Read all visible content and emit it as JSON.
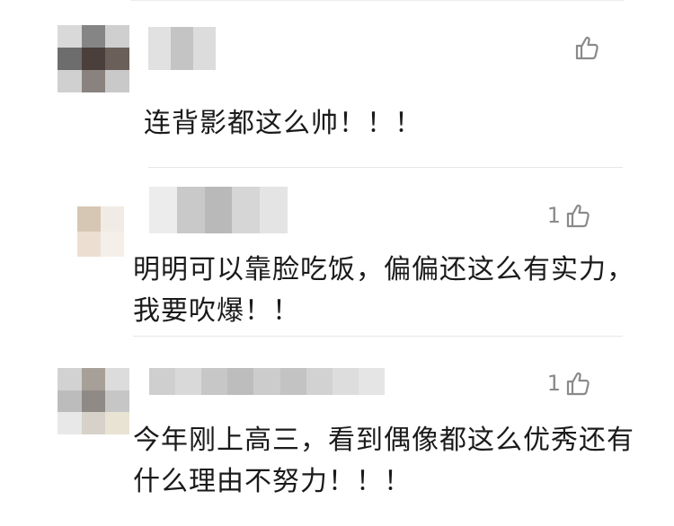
{
  "comments": [
    {
      "like_count": "",
      "text": "连背影都这么帅！！！",
      "avatar_colors": [
        "#d9d9d9",
        "#858585",
        "#cfcfcf",
        "#6d6d6d",
        "#4a3f3b",
        "#6b5f59",
        "#d0d0d0",
        "#8a827e",
        "#c9c9c9"
      ],
      "name_colors": [
        "#e1e1e1",
        "#c4c4c4",
        "#dcdcdc"
      ]
    },
    {
      "like_count": "1",
      "text": "明明可以靠脸吃饭，偏偏还这么有实力，我要吹爆！！",
      "avatar_colors": [
        "#d6c6b4",
        "#f0ebe5",
        "#ecdfd2",
        "#f5efe9"
      ],
      "name_colors": [
        "#ececec",
        "#c9c9c9",
        "#b9b9b9",
        "#d6d6d6",
        "#e4e4e4"
      ]
    },
    {
      "like_count": "1",
      "text": "今年刚上高三，看到偶像都这么优秀还有什么理由不努力！！！",
      "avatar_colors": [
        "#d2d2d2",
        "#a6a099",
        "#dcdcdc",
        "#bcbcbc",
        "#8f8a86",
        "#c6c6c6",
        "#e8e8e8",
        "#d7d2c9",
        "#e9e3d4"
      ],
      "name_colors": [
        "#cfcfcf",
        "#d9d9d9",
        "#c7c7c7",
        "#bdbdbd",
        "#cccccc",
        "#c3c3c3",
        "#d2d2d2",
        "#dddddd",
        "#e5e5e5"
      ]
    }
  ]
}
